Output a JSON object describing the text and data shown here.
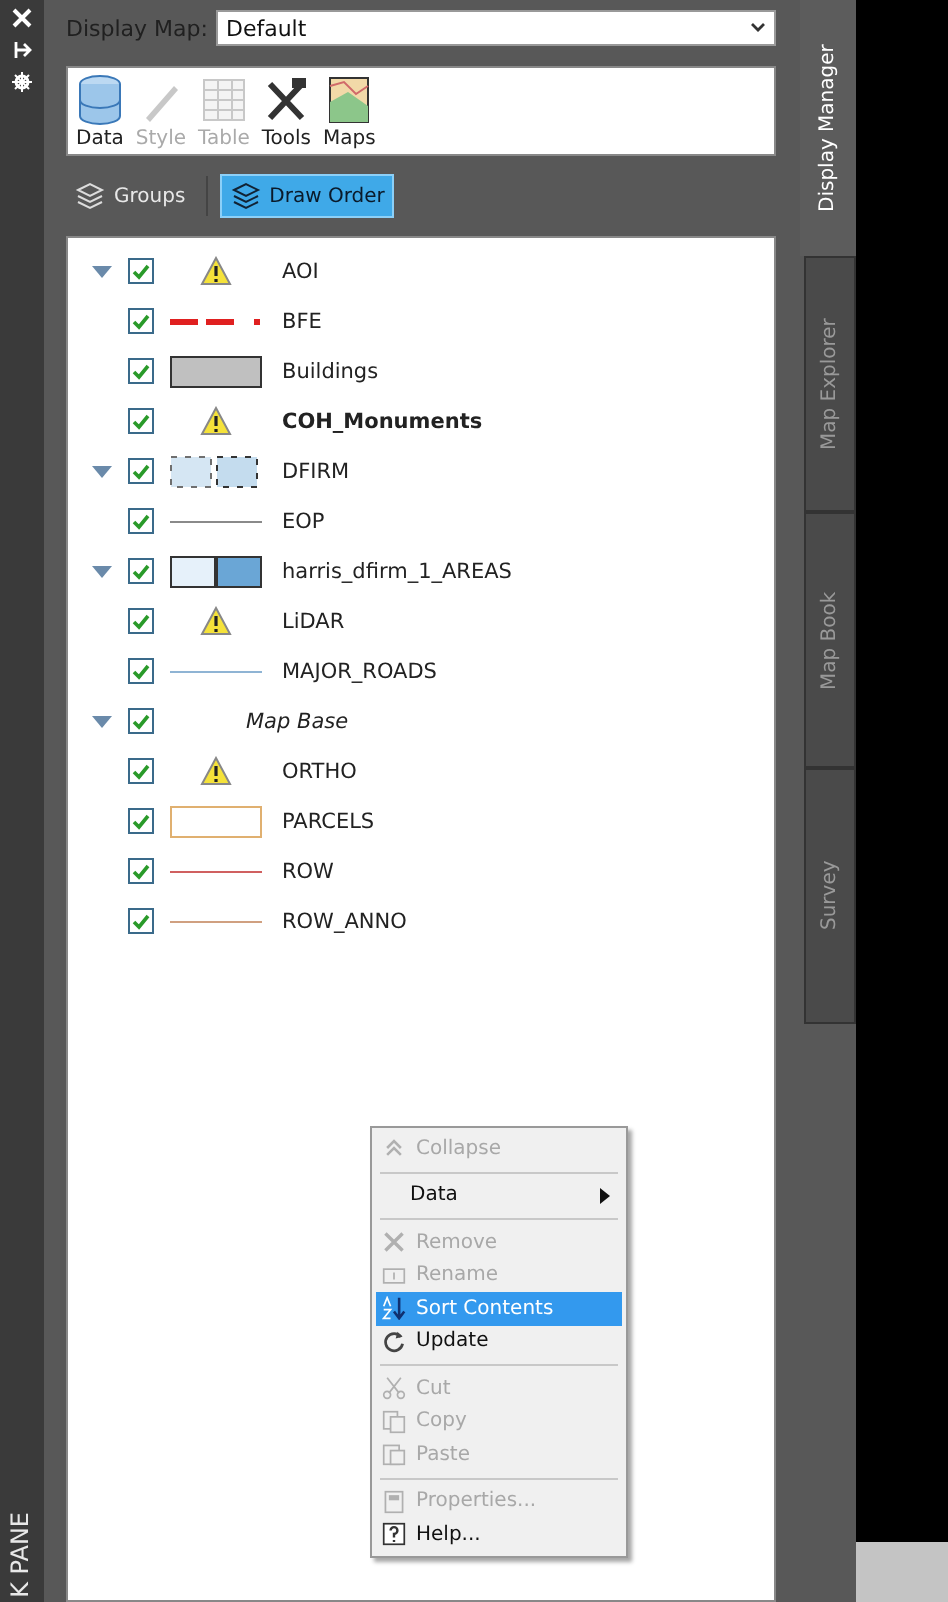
{
  "left_strip": {
    "pane_label": "K PANE"
  },
  "display_map": {
    "label": "Display Map:",
    "value": "Default"
  },
  "toolbar": [
    {
      "label": "Data",
      "disabled": false
    },
    {
      "label": "Style",
      "disabled": true
    },
    {
      "label": "Table",
      "disabled": true
    },
    {
      "label": "Tools",
      "disabled": false
    },
    {
      "label": "Maps",
      "disabled": false
    }
  ],
  "view_tabs": [
    {
      "label": "Groups",
      "selected": false
    },
    {
      "label": "Draw Order",
      "selected": true
    }
  ],
  "layers": [
    {
      "name": "AOI",
      "kind": "group",
      "expanded": true,
      "checked": true,
      "active": false,
      "symbol": {
        "kind": "warning"
      }
    },
    {
      "name": "BFE",
      "kind": "layer",
      "checked": true,
      "active": false,
      "symbol": {
        "kind": "dash",
        "color": "#e02020"
      }
    },
    {
      "name": "Buildings",
      "kind": "layer",
      "checked": true,
      "active": false,
      "symbol": {
        "kind": "fill",
        "color": "#c0c0c0"
      }
    },
    {
      "name": "COH_Monuments",
      "kind": "layer",
      "checked": true,
      "active": true,
      "symbol": {
        "kind": "warning"
      }
    },
    {
      "name": "DFIRM",
      "kind": "group",
      "expanded": true,
      "checked": true,
      "active": false,
      "symbol": {
        "kind": "dashed-boxes",
        "color": "#c4dcee"
      }
    },
    {
      "name": "EOP",
      "kind": "layer",
      "checked": true,
      "active": false,
      "symbol": {
        "kind": "line",
        "color": "#8a8a8a"
      }
    },
    {
      "name": "harris_dfirm_1_AREAS",
      "kind": "group",
      "expanded": true,
      "checked": true,
      "active": false,
      "symbol": {
        "kind": "two-boxes",
        "color": "#6aa6d6"
      }
    },
    {
      "name": "LiDAR",
      "kind": "layer",
      "checked": true,
      "active": false,
      "symbol": {
        "kind": "warning"
      }
    },
    {
      "name": "MAJOR_ROADS",
      "kind": "layer",
      "checked": true,
      "active": false,
      "symbol": {
        "kind": "line",
        "color": "#8fb4d4"
      }
    },
    {
      "name": "Map Base",
      "kind": "base-group",
      "expanded": true,
      "checked": true,
      "active": false,
      "symbol": {
        "kind": "none"
      }
    },
    {
      "name": "ORTHO",
      "kind": "layer",
      "checked": true,
      "active": false,
      "symbol": {
        "kind": "warning"
      }
    },
    {
      "name": "PARCELS",
      "kind": "layer",
      "checked": true,
      "active": false,
      "symbol": {
        "kind": "outline",
        "color": "#e0b070"
      }
    },
    {
      "name": "ROW",
      "kind": "layer",
      "checked": true,
      "active": false,
      "symbol": {
        "kind": "line",
        "color": "#d06060"
      }
    },
    {
      "name": "ROW_ANNO",
      "kind": "layer",
      "checked": true,
      "active": false,
      "symbol": {
        "kind": "line",
        "color": "#d0a080"
      }
    }
  ],
  "context_menu": [
    {
      "kind": "item",
      "label": "Collapse",
      "disabled": true,
      "selected": false
    },
    {
      "kind": "separator"
    },
    {
      "kind": "submenu",
      "label": "Data",
      "disabled": false,
      "selected": false
    },
    {
      "kind": "separator"
    },
    {
      "kind": "item",
      "label": "Remove",
      "disabled": true,
      "selected": false
    },
    {
      "kind": "item",
      "label": "Rename",
      "disabled": true,
      "selected": false
    },
    {
      "kind": "item",
      "label": "Sort Contents",
      "disabled": false,
      "selected": true
    },
    {
      "kind": "item",
      "label": "Update",
      "disabled": false,
      "selected": false
    },
    {
      "kind": "separator"
    },
    {
      "kind": "item",
      "label": "Cut",
      "disabled": true,
      "selected": false
    },
    {
      "kind": "item",
      "label": "Copy",
      "disabled": true,
      "selected": false
    },
    {
      "kind": "item",
      "label": "Paste",
      "disabled": true,
      "selected": false
    },
    {
      "kind": "separator"
    },
    {
      "kind": "item",
      "label": "Properties...",
      "disabled": true,
      "selected": false
    },
    {
      "kind": "item",
      "label": "Help...",
      "disabled": false,
      "selected": false
    }
  ],
  "side_tabs": [
    {
      "label": "Display Manager",
      "selected": true
    },
    {
      "label": "Map Explorer",
      "selected": false
    },
    {
      "label": "Map Book",
      "selected": false
    },
    {
      "label": "Survey",
      "selected": false
    }
  ]
}
